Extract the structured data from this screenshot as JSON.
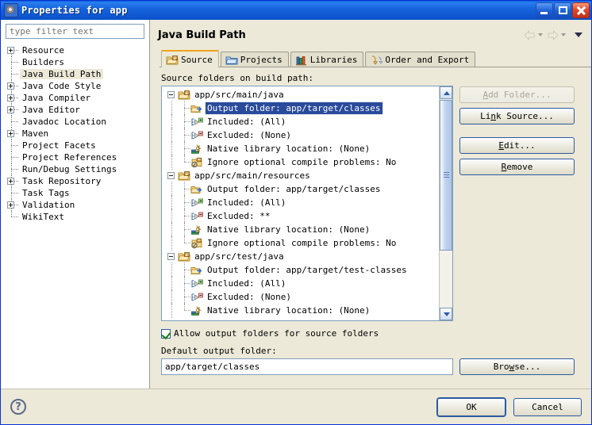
{
  "window": {
    "title": "Properties for app",
    "icon": "properties-gear-icon",
    "controls": {
      "minimize": "minimize",
      "maximize": "maximize",
      "close": "close"
    }
  },
  "sidebar": {
    "filter": {
      "placeholder": "type filter text",
      "value": ""
    },
    "items": [
      {
        "label": "Resource",
        "expandable": true,
        "selected": false
      },
      {
        "label": "Builders",
        "expandable": false,
        "selected": false
      },
      {
        "label": "Java Build Path",
        "expandable": false,
        "selected": true
      },
      {
        "label": "Java Code Style",
        "expandable": true,
        "selected": false
      },
      {
        "label": "Java Compiler",
        "expandable": true,
        "selected": false
      },
      {
        "label": "Java Editor",
        "expandable": true,
        "selected": false
      },
      {
        "label": "Javadoc Location",
        "expandable": false,
        "selected": false
      },
      {
        "label": "Maven",
        "expandable": true,
        "selected": false
      },
      {
        "label": "Project Facets",
        "expandable": false,
        "selected": false
      },
      {
        "label": "Project References",
        "expandable": false,
        "selected": false
      },
      {
        "label": "Run/Debug Settings",
        "expandable": false,
        "selected": false
      },
      {
        "label": "Task Repository",
        "expandable": true,
        "selected": false
      },
      {
        "label": "Task Tags",
        "expandable": false,
        "selected": false
      },
      {
        "label": "Validation",
        "expandable": true,
        "selected": false
      },
      {
        "label": "WikiText",
        "expandable": false,
        "selected": false
      }
    ]
  },
  "page": {
    "title": "Java Build Path",
    "nav": {
      "back": "back-arrow",
      "forward": "forward-arrow",
      "menu": "view-menu-caret"
    }
  },
  "tabs": [
    {
      "label": "Source",
      "icon": "source-folder-icon",
      "active": true
    },
    {
      "label": "Projects",
      "icon": "projects-folder-icon",
      "active": false
    },
    {
      "label": "Libraries",
      "icon": "libraries-books-icon",
      "active": false
    },
    {
      "label": "Order and Export",
      "icon": "order-export-icon",
      "active": false
    }
  ],
  "source_tab": {
    "section_label": "Source folders on build path:",
    "tree": [
      {
        "label": "app/src/main/java",
        "icon": "source-folder-icon",
        "children": [
          {
            "label": "Output folder: app/target/classes",
            "icon": "output-folder-icon",
            "selected": true
          },
          {
            "label": "Included: (All)",
            "icon": "included-icon",
            "selected": false
          },
          {
            "label": "Excluded: (None)",
            "icon": "excluded-icon",
            "selected": false
          },
          {
            "label": "Native library location: (None)",
            "icon": "native-library-icon",
            "selected": false
          },
          {
            "label": "Ignore optional compile problems: No",
            "icon": "ignore-problems-icon",
            "selected": false
          }
        ]
      },
      {
        "label": "app/src/main/resources",
        "icon": "source-folder-icon",
        "children": [
          {
            "label": "Output folder: app/target/classes",
            "icon": "output-folder-icon",
            "selected": false
          },
          {
            "label": "Included: (All)",
            "icon": "included-icon",
            "selected": false
          },
          {
            "label": "Excluded: **",
            "icon": "excluded-icon",
            "selected": false
          },
          {
            "label": "Native library location: (None)",
            "icon": "native-library-icon",
            "selected": false
          },
          {
            "label": "Ignore optional compile problems: No",
            "icon": "ignore-problems-icon",
            "selected": false
          }
        ]
      },
      {
        "label": "app/src/test/java",
        "icon": "source-folder-icon",
        "children": [
          {
            "label": "Output folder: app/target/test-classes",
            "icon": "output-folder-icon",
            "selected": false
          },
          {
            "label": "Included: (All)",
            "icon": "included-icon",
            "selected": false
          },
          {
            "label": "Excluded: (None)",
            "icon": "excluded-icon",
            "selected": false
          },
          {
            "label": "Native library location: (None)",
            "icon": "native-library-icon",
            "selected": false
          }
        ]
      }
    ],
    "buttons": [
      {
        "label": "Add Folder...",
        "mnemonic": "A",
        "enabled": false
      },
      {
        "label": "Link Source...",
        "mnemonic": "n",
        "enabled": true
      },
      {
        "label": "Edit...",
        "mnemonic": "E",
        "enabled": true
      },
      {
        "label": "Remove",
        "mnemonic": "R",
        "enabled": true
      }
    ],
    "allow_output_checkbox": {
      "label": "Allow output folders for source folders",
      "checked": true
    },
    "default_output": {
      "label": "Default output folder:",
      "value": "app/target/classes",
      "browse_label": "Browse...",
      "browse_mnemonic": "w"
    }
  },
  "footer": {
    "help": "help-icon",
    "ok_label": "OK",
    "cancel_label": "Cancel"
  },
  "colors": {
    "title_blue": "#0a5ad8",
    "dialog_bg": "#ece9d8",
    "selection_blue": "#2a4b9b",
    "active_tab_accent": "#f2a11c",
    "field_border": "#7f9db9"
  }
}
